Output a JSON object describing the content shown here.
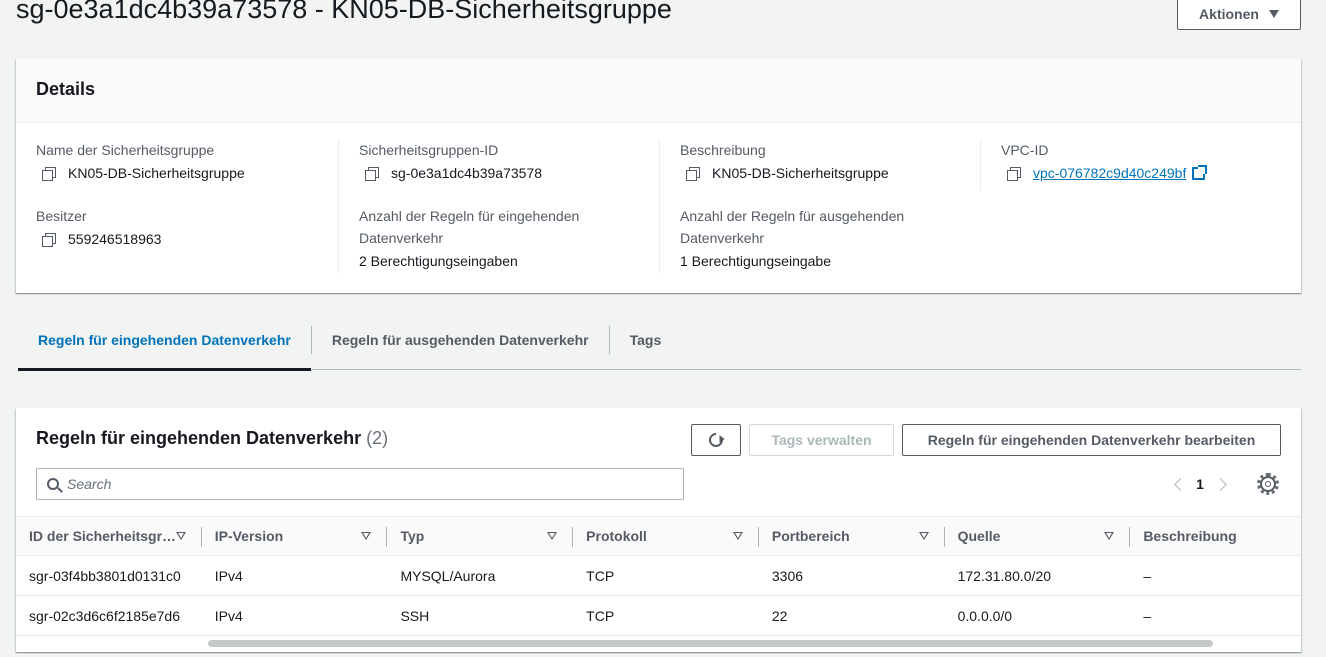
{
  "page": {
    "title": "sg-0e3a1dc4b39a73578 - KN05-DB-Sicherheitsgruppe",
    "actions_label": "Aktionen"
  },
  "details": {
    "heading": "Details",
    "name_label": "Name der Sicherheitsgruppe",
    "name_value": "KN05-DB-Sicherheitsgruppe",
    "id_label": "Sicherheitsgruppen-ID",
    "id_value": "sg-0e3a1dc4b39a73578",
    "desc_label": "Beschreibung",
    "desc_value": "KN05-DB-Sicherheitsgruppe",
    "vpc_label": "VPC-ID",
    "vpc_value": "vpc-076782c9d40c249bf",
    "owner_label": "Besitzer",
    "owner_value": "559246518963",
    "inbound_count_label": "Anzahl der Regeln für eingehenden Datenverkehr",
    "inbound_count_value": "2 Berechtigungseingaben",
    "outbound_count_label": "Anzahl der Regeln für ausgehenden Datenverkehr",
    "outbound_count_value": "1 Berechtigungseingabe"
  },
  "tabs": [
    {
      "label": "Regeln für eingehenden Datenverkehr",
      "active": true
    },
    {
      "label": "Regeln für ausgehenden Datenverkehr",
      "active": false
    },
    {
      "label": "Tags",
      "active": false
    }
  ],
  "rules": {
    "heading": "Regeln für eingehenden Datenverkehr",
    "count": "(2)",
    "manage_tags_label": "Tags verwalten",
    "edit_label": "Regeln für eingehenden Datenverkehr bearbeiten",
    "search_placeholder": "Search",
    "page_number": "1",
    "columns": [
      "ID der Sicherheitsgruppenregel",
      "IP-Version",
      "Typ",
      "Protokoll",
      "Portbereich",
      "Quelle",
      "Beschreibung"
    ],
    "rows": [
      [
        "sgr-03f4bb3801d0131c0",
        "IPv4",
        "MYSQL/Aurora",
        "TCP",
        "3306",
        "172.31.80.0/20",
        "–"
      ],
      [
        "sgr-02c3d6c6f2185e7d6",
        "IPv4",
        "SSH",
        "TCP",
        "22",
        "0.0.0.0/0",
        "–"
      ]
    ]
  },
  "icons": {
    "copy": "copy-icon",
    "external": "external-link-icon",
    "refresh": "refresh-icon",
    "search": "search-icon",
    "settings": "gear-icon"
  },
  "colors": {
    "accent": "#0073bb",
    "text": "#16191f",
    "muted": "#545b64"
  }
}
